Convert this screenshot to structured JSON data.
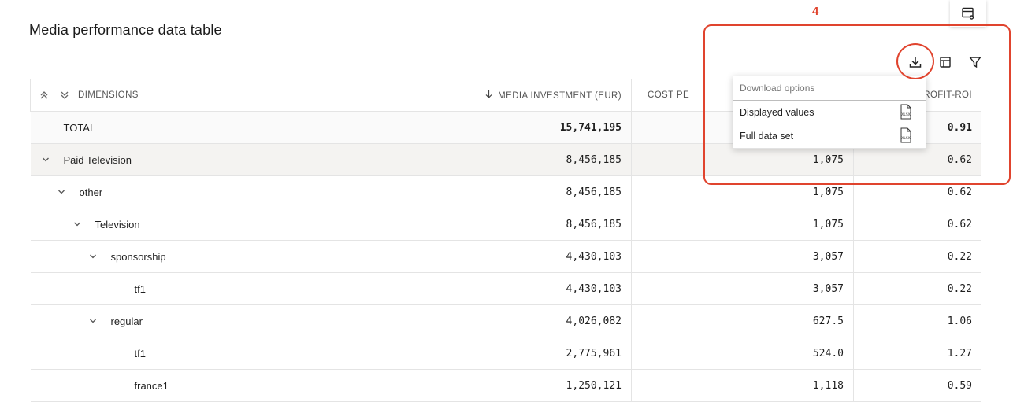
{
  "page": {
    "title": "Media performance data table"
  },
  "annotation": {
    "step_number": "4",
    "color": "#e0442e"
  },
  "icons": {
    "corner": "table-settings-icon",
    "download": "download-icon",
    "columns": "columns-icon",
    "filter": "filter-icon",
    "expand_all": "expand-all-icon",
    "collapse_all": "collapse-all-icon",
    "xlsx": "xlsx-file-icon"
  },
  "table": {
    "headers": {
      "dimensions": "DIMENSIONS",
      "media_investment": "MEDIA INVESTMENT (EUR)",
      "cost": "COST PE",
      "profit_roi": "ROFIT-ROI"
    },
    "total": {
      "label": "TOTAL",
      "media_investment": "15,741,195",
      "cost": "",
      "profit_roi": "0.91"
    },
    "rows": [
      {
        "label": "Paid Television",
        "media_investment": "8,456,185",
        "cost": "1,075",
        "profit_roi": "0.62"
      },
      {
        "label": "other",
        "media_investment": "8,456,185",
        "cost": "1,075",
        "profit_roi": "0.62"
      },
      {
        "label": "Television",
        "media_investment": "8,456,185",
        "cost": "1,075",
        "profit_roi": "0.62"
      },
      {
        "label": "sponsorship",
        "media_investment": "4,430,103",
        "cost": "3,057",
        "profit_roi": "0.22"
      },
      {
        "label": "tf1",
        "media_investment": "4,430,103",
        "cost": "3,057",
        "profit_roi": "0.22"
      },
      {
        "label": "regular",
        "media_investment": "4,026,082",
        "cost": "627.5",
        "profit_roi": "1.06"
      },
      {
        "label": "tf1",
        "media_investment": "2,775,961",
        "cost": "524.0",
        "profit_roi": "1.27"
      },
      {
        "label": "france1",
        "media_investment": "1,250,121",
        "cost": "1,118",
        "profit_roi": "0.59"
      }
    ]
  },
  "download_menu": {
    "header": "Download options",
    "options": [
      {
        "label": "Displayed values",
        "format": "XLSX"
      },
      {
        "label": "Full data set",
        "format": "XLSX"
      }
    ]
  }
}
